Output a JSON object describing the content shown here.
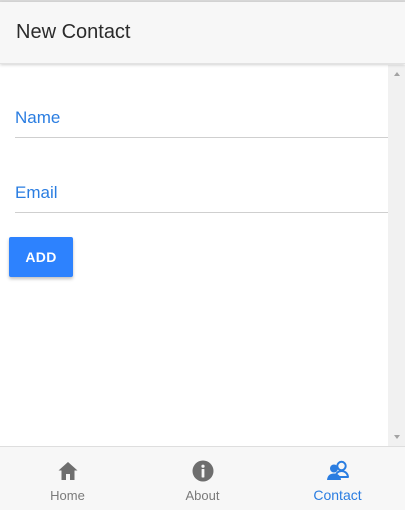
{
  "header": {
    "title": "New Contact"
  },
  "form": {
    "name_placeholder": "Name",
    "email_placeholder": "Email",
    "add_label": "ADD"
  },
  "tabbar": {
    "tabs": [
      {
        "label": "Home",
        "icon": "home-icon",
        "active": false
      },
      {
        "label": "About",
        "icon": "info-icon",
        "active": false
      },
      {
        "label": "Contact",
        "icon": "contacts-icon",
        "active": true
      }
    ]
  },
  "colors": {
    "accent": "#2d82fe",
    "active_tab": "#2a7de1",
    "inactive_tab": "#7a7a7a",
    "header_bg": "#f7f7f7"
  }
}
